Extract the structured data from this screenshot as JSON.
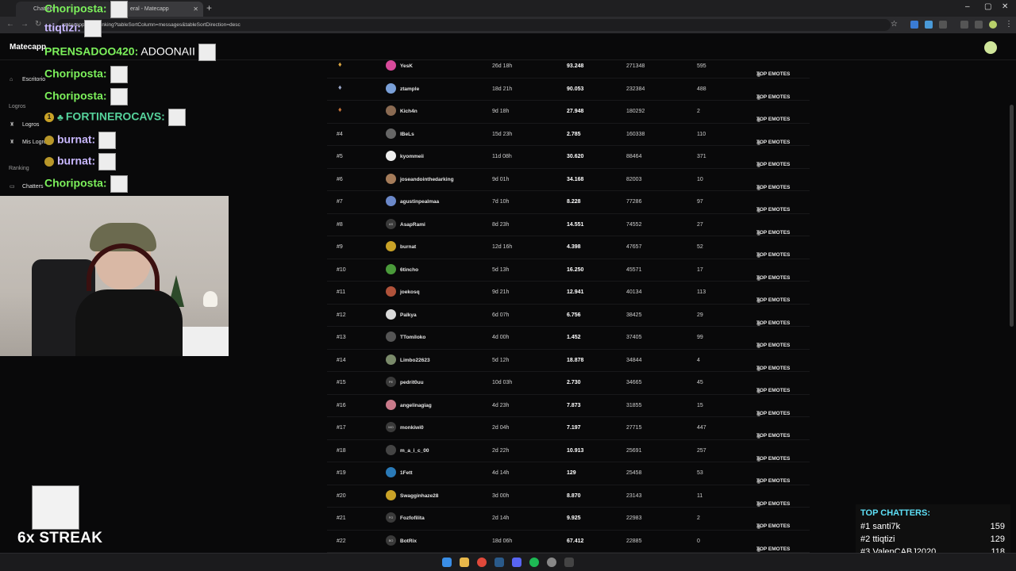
{
  "browser": {
    "tabs": [
      {
        "label": "Chatters"
      },
      {
        "label": "eral - Matecapp"
      }
    ],
    "url": "matecapp.com/ranking?tableSortColumn=messages&tableSortDirection=desc"
  },
  "app": {
    "brand": "Matecapp",
    "sidebar": {
      "items": [
        {
          "type": "item",
          "label": "Escritorio",
          "icon": "home-icon"
        },
        {
          "type": "group",
          "label": "Logros"
        },
        {
          "type": "item",
          "label": "Logros",
          "icon": "trophy-icon"
        },
        {
          "type": "item",
          "label": "Mis Logros",
          "icon": "trophy-icon"
        },
        {
          "type": "group",
          "label": "Ranking"
        },
        {
          "type": "item",
          "label": "Chatters",
          "icon": "chat-icon"
        }
      ]
    },
    "table": {
      "top_label": "TOP EMOTES",
      "rows": [
        {
          "rank": "",
          "medal": "gold",
          "name": "YesK",
          "time": "26d 18h",
          "points": "93.248",
          "messages": "271348",
          "emotes": "595",
          "avatar": "#d84a9a"
        },
        {
          "rank": "",
          "medal": "silver",
          "name": "ztample",
          "time": "18d 21h",
          "points": "90.053",
          "messages": "232384",
          "emotes": "488",
          "avatar": "#7aa0d8"
        },
        {
          "rank": "",
          "medal": "bronze",
          "name": "Kich4n",
          "time": "9d 18h",
          "points": "27.948",
          "messages": "180292",
          "emotes": "2",
          "avatar": "#8a6a52"
        },
        {
          "rank": "#4",
          "medal": "",
          "name": "lBeLs",
          "time": "15d 23h",
          "points": "2.785",
          "messages": "160338",
          "emotes": "110",
          "avatar": "#666"
        },
        {
          "rank": "#5",
          "medal": "",
          "name": "kyommeii",
          "time": "11d 08h",
          "points": "30.620",
          "messages": "88464",
          "emotes": "371",
          "avatar": "#eee"
        },
        {
          "rank": "#6",
          "medal": "",
          "name": "joseandointhedarking",
          "time": "9d 01h",
          "points": "34.168",
          "messages": "82003",
          "emotes": "10",
          "avatar": "#a57c5a"
        },
        {
          "rank": "#7",
          "medal": "",
          "name": "agustinpealmaa",
          "time": "7d 10h",
          "points": "8.228",
          "messages": "77286",
          "emotes": "97",
          "avatar": "#6b88c9"
        },
        {
          "rank": "#8",
          "medal": "",
          "name": "AsapRami",
          "time": "8d 23h",
          "points": "14.551",
          "messages": "74552",
          "emotes": "27",
          "avatar": "#3a3a3a",
          "initials": "AS"
        },
        {
          "rank": "#9",
          "medal": "",
          "name": "burnat",
          "time": "12d 16h",
          "points": "4.398",
          "messages": "47657",
          "emotes": "52",
          "avatar": "#c9a227"
        },
        {
          "rank": "#10",
          "medal": "",
          "name": "6tincho",
          "time": "5d 13h",
          "points": "16.250",
          "messages": "45571",
          "emotes": "17",
          "avatar": "#4a9a3a"
        },
        {
          "rank": "#11",
          "medal": "",
          "name": "joekosq",
          "time": "9d 21h",
          "points": "12.941",
          "messages": "40134",
          "emotes": "113",
          "avatar": "#b0523a"
        },
        {
          "rank": "#12",
          "medal": "",
          "name": "Palkya",
          "time": "6d 07h",
          "points": "6.756",
          "messages": "38425",
          "emotes": "29",
          "avatar": "#d9d9d9"
        },
        {
          "rank": "#13",
          "medal": "",
          "name": "TTomiloko",
          "time": "4d 00h",
          "points": "1.452",
          "messages": "37405",
          "emotes": "99",
          "avatar": "#555"
        },
        {
          "rank": "#14",
          "medal": "",
          "name": "Limbo22623",
          "time": "5d 12h",
          "points": "18.878",
          "messages": "34844",
          "emotes": "4",
          "avatar": "#7a8a6a"
        },
        {
          "rank": "#15",
          "medal": "",
          "name": "pedrit0uu",
          "time": "10d 03h",
          "points": "2.730",
          "messages": "34665",
          "emotes": "45",
          "avatar": "#3a3a3a",
          "initials": "PE"
        },
        {
          "rank": "#16",
          "medal": "",
          "name": "angelinagiag",
          "time": "4d 23h",
          "points": "7.873",
          "messages": "31855",
          "emotes": "15",
          "avatar": "#c97a8a"
        },
        {
          "rank": "#17",
          "medal": "",
          "name": "monkiwi0",
          "time": "2d 04h",
          "points": "7.197",
          "messages": "27715",
          "emotes": "447",
          "avatar": "#3a3a3a",
          "initials": "MO"
        },
        {
          "rank": "#18",
          "medal": "",
          "name": "m_a_i_c_00",
          "time": "2d 22h",
          "points": "10.913",
          "messages": "25691",
          "emotes": "257",
          "avatar": "#444"
        },
        {
          "rank": "#19",
          "medal": "",
          "name": "1Fett",
          "time": "4d 14h",
          "points": "129",
          "messages": "25458",
          "emotes": "53",
          "avatar": "#2a7ab8"
        },
        {
          "rank": "#20",
          "medal": "",
          "name": "Swagginhaze28",
          "time": "3d 00h",
          "points": "8.870",
          "messages": "23143",
          "emotes": "11",
          "avatar": "#c9a227"
        },
        {
          "rank": "#21",
          "medal": "",
          "name": "Fozfofilita",
          "time": "2d 14h",
          "points": "9.925",
          "messages": "22983",
          "emotes": "2",
          "avatar": "#3a3a3a",
          "initials": "FO"
        },
        {
          "rank": "#22",
          "medal": "",
          "name": "BotRix",
          "time": "18d 06h",
          "points": "67.412",
          "messages": "22885",
          "emotes": "0",
          "avatar": "#3a3a3a",
          "initials": "BO"
        }
      ]
    }
  },
  "overlay": {
    "chat": [
      {
        "user": "Choriposta:",
        "msg": "",
        "emote": true,
        "color": "green"
      },
      {
        "user": "ttiqtizi:",
        "msg": "",
        "emote": true,
        "color": "lavender"
      },
      {
        "user": "PRENSADOO420:",
        "msg": " ADOONAII",
        "emote": true,
        "color": "green"
      },
      {
        "user": "Choriposta:",
        "msg": "",
        "emote": true,
        "color": "green"
      },
      {
        "user": "Choriposta:",
        "msg": "",
        "emote": true,
        "color": "green"
      },
      {
        "user": "FORTINEROCAVS:",
        "msg": "",
        "emote": true,
        "color": "teal",
        "badge": "1"
      },
      {
        "user": "burnat:",
        "msg": "",
        "emote": true,
        "color": "lavender",
        "coin": true
      },
      {
        "user": "burnat:",
        "msg": "",
        "emote": true,
        "color": "lavender",
        "coin": true
      },
      {
        "user": "Choriposta:",
        "msg": "",
        "emote": true,
        "color": "green"
      }
    ],
    "streak": "6x STREAK",
    "top_chatters": {
      "title": "TOP CHATTERS:",
      "entries": [
        {
          "rank": "#1",
          "name": "santi7k",
          "count": "159"
        },
        {
          "rank": "#2",
          "name": "ttiqtizi",
          "count": "129"
        },
        {
          "rank": "#3",
          "name": "ValenCABJ2020",
          "count": "118"
        }
      ]
    }
  }
}
